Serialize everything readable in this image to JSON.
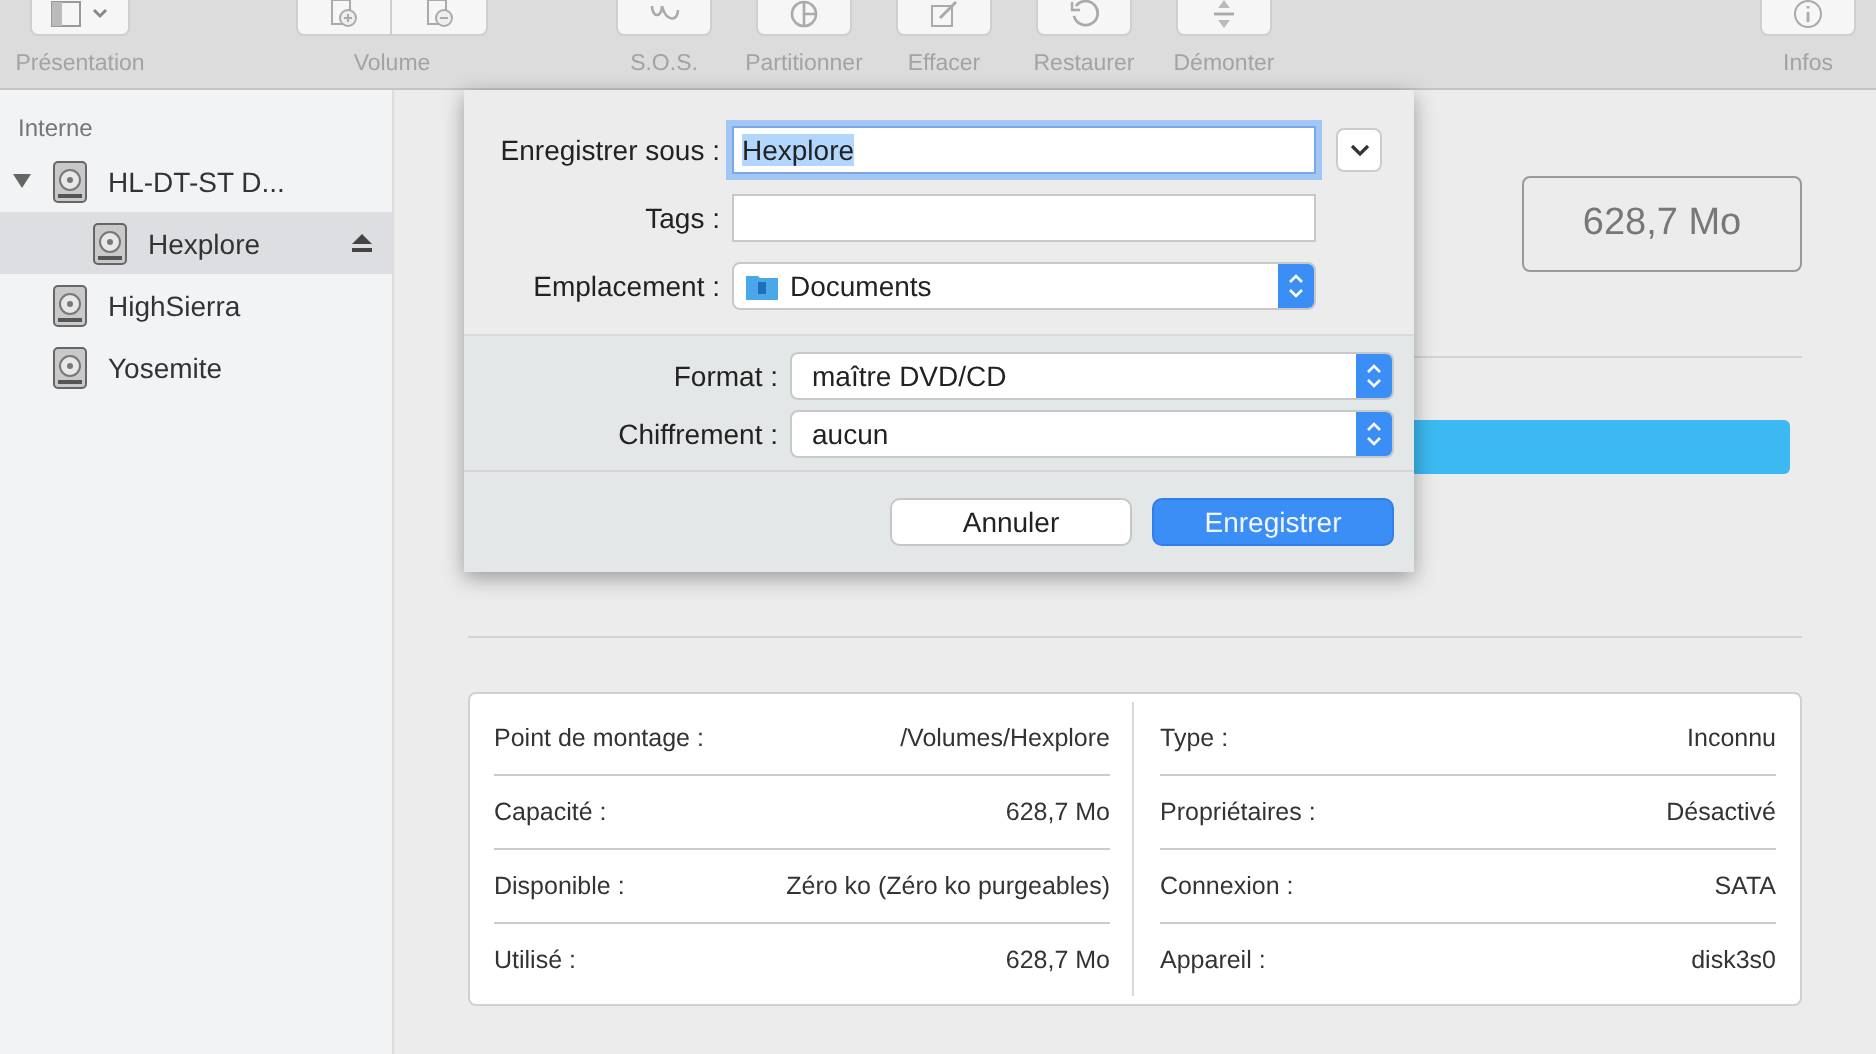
{
  "toolbar": {
    "groups": [
      {
        "label": "Présentation",
        "kind": "view"
      },
      {
        "label": "Volume",
        "kind": "volume"
      },
      {
        "label": "S.O.S.",
        "kind": "sos"
      },
      {
        "label": "Partitionner",
        "kind": "partition"
      },
      {
        "label": "Effacer",
        "kind": "erase"
      },
      {
        "label": "Restaurer",
        "kind": "restore"
      },
      {
        "label": "Démonter",
        "kind": "unmount"
      },
      {
        "label": "Infos",
        "kind": "info"
      }
    ]
  },
  "sidebar": {
    "section": "Interne",
    "items": [
      {
        "name": "HL-DT-ST D...",
        "expanded": true,
        "selected": false,
        "children": [
          {
            "name": "Hexplore",
            "selected": true,
            "ejectable": true
          }
        ]
      },
      {
        "name": "HighSierra",
        "selected": false
      },
      {
        "name": "Yosemite",
        "selected": false
      }
    ]
  },
  "main": {
    "capacity": "628,7 Mo",
    "info": {
      "left": [
        {
          "label": "Point de montage :",
          "value": "/Volumes/Hexplore"
        },
        {
          "label": "Capacité :",
          "value": "628,7 Mo"
        },
        {
          "label": "Disponible :",
          "value": "Zéro ko (Zéro ko purgeables)"
        },
        {
          "label": "Utilisé :",
          "value": "628,7 Mo"
        }
      ],
      "right": [
        {
          "label": "Type :",
          "value": "Inconnu"
        },
        {
          "label": "Propriétaires :",
          "value": "Désactivé"
        },
        {
          "label": "Connexion :",
          "value": "SATA"
        },
        {
          "label": "Appareil :",
          "value": "disk3s0"
        }
      ]
    }
  },
  "sheet": {
    "save_as": {
      "label": "Enregistrer sous :",
      "value": "Hexplore"
    },
    "tags": {
      "label": "Tags :"
    },
    "location": {
      "label": "Emplacement :",
      "value": "Documents"
    },
    "format": {
      "label": "Format :",
      "value": "maître DVD/CD"
    },
    "encryption": {
      "label": "Chiffrement :",
      "value": "aucun"
    },
    "buttons": [
      {
        "label": "Annuler",
        "kind": "cancel"
      },
      {
        "label": "Enregistrer",
        "kind": "default"
      }
    ]
  }
}
